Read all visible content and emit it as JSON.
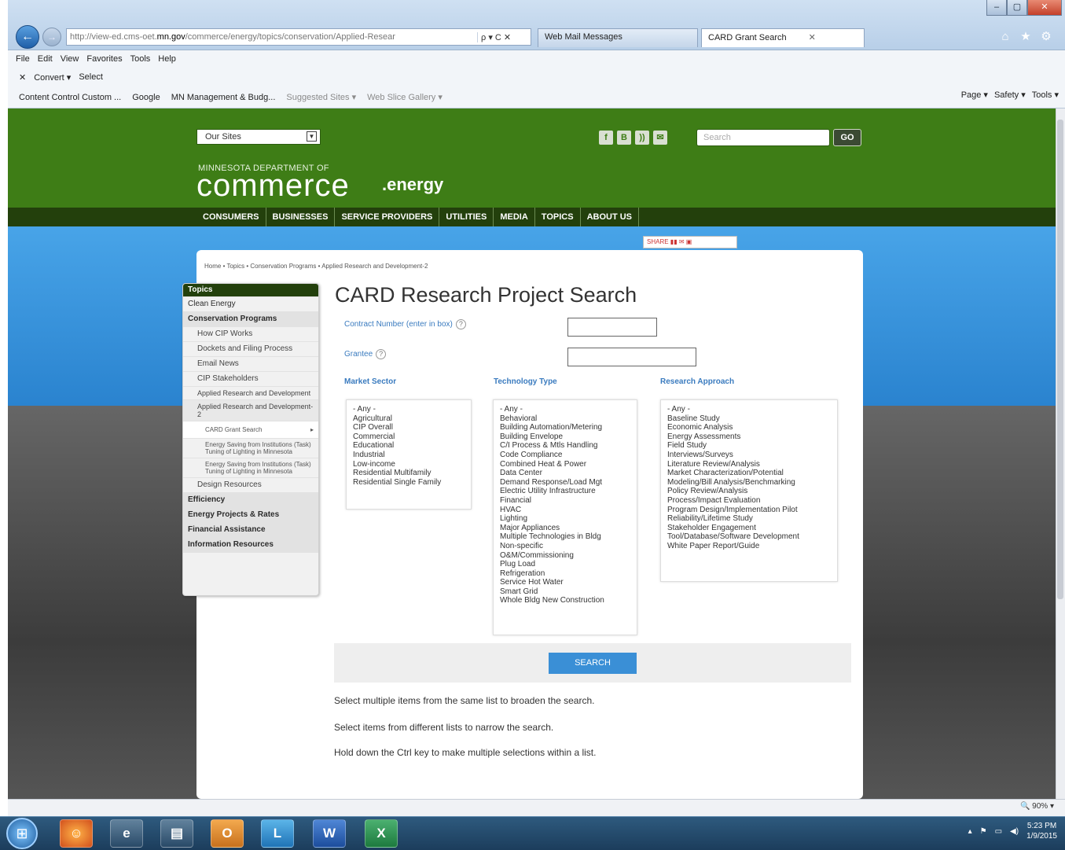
{
  "browser": {
    "address_url_prefix": "http://view-ed.cms-oet.",
    "address_url_host": "mn.gov",
    "address_url_path": "/commerce/energy/topics/conservation/Applied-Resear",
    "address_controls": "ρ ▾ C ✕",
    "tabs": [
      {
        "label": "Web Mail Messages"
      },
      {
        "label": "CARD Grant Search"
      }
    ],
    "tab_close": "✕",
    "menu": [
      "File",
      "Edit",
      "View",
      "Favorites",
      "Tools",
      "Help"
    ],
    "toolbar2": [
      "Convert ▾",
      "Select"
    ],
    "toolbar2_close": "✕",
    "favorites": [
      "Content Control Custom ...",
      "Google",
      "MN Management & Budg...",
      "Suggested Sites ▾",
      "Web Slice Gallery ▾"
    ],
    "command_bar": [
      "Page ▾",
      "Safety ▾",
      "Tools ▾"
    ],
    "window_buttons": [
      "–",
      "▢",
      "✕"
    ]
  },
  "site": {
    "our_sites_label": "Our Sites",
    "search_placeholder": "Search",
    "go_label": "GO",
    "logo_sub": "MINNESOTA DEPARTMENT OF",
    "logo_main": "commerce",
    "logo_suffix": ".energy",
    "nav": [
      "CONSUMERS",
      "BUSINESSES",
      "SERVICE PROVIDERS",
      "UTILITIES",
      "MEDIA",
      "TOPICS",
      "ABOUT US"
    ],
    "share_label": "SHARE",
    "breadcrumb": "Home  •  Topics  •  Conservation Programs  •  Applied Research and Development-2"
  },
  "sidebar": {
    "header": "Topics",
    "items": [
      {
        "label": "Clean Energy"
      },
      {
        "label": "Conservation Programs"
      },
      {
        "label": "How CIP Works"
      },
      {
        "label": "Dockets and Filing Process"
      },
      {
        "label": "Email News"
      },
      {
        "label": "CIP Stakeholders"
      },
      {
        "label": "Applied Research and Development"
      },
      {
        "label": "Applied Research and Development-2"
      },
      {
        "label": "CARD Grant Search"
      },
      {
        "label": "Energy Saving from Institutions (Task) Tuning of Lighting in Minnesota"
      },
      {
        "label": "Energy Saving from Institutions (Task) Tuning of Lighting in Minnesota"
      },
      {
        "label": "Design Resources"
      },
      {
        "label": "Efficiency"
      },
      {
        "label": "Energy Projects & Rates"
      },
      {
        "label": "Financial Assistance"
      },
      {
        "label": "Information Resources"
      }
    ]
  },
  "form": {
    "title": "CARD Research Project Search",
    "contract_label": "Contract Number (enter in box)",
    "grantee_label": "Grantee",
    "help_glyph": "?",
    "market_sector_label": "Market Sector",
    "technology_type_label": "Technology Type",
    "research_approach_label": "Research Approach",
    "market_sector_options": [
      "- Any -",
      "Agricultural",
      "CIP Overall",
      "Commercial",
      "Educational",
      "Industrial",
      "Low-income",
      "Residential Multifamily",
      "Residential Single Family"
    ],
    "technology_type_options": [
      "- Any -",
      "Behavioral",
      "Building Automation/Metering",
      "Building Envelope",
      "C/I Process & Mtls Handling",
      "Code Compliance",
      "Combined Heat & Power",
      "Data Center",
      "Demand Response/Load Mgt",
      "Electric Utility Infrastructure",
      "Financial",
      "HVAC",
      "Lighting",
      "Major Appliances",
      "Multiple Technologies in Bldg",
      "Non-specific",
      "O&M/Commissioning",
      "Plug Load",
      "Refrigeration",
      "Service Hot Water",
      "Smart Grid",
      "Whole Bldg New Construction"
    ],
    "research_approach_options": [
      "- Any -",
      "Baseline Study",
      "Economic Analysis",
      "Energy Assessments",
      "Field Study",
      "Interviews/Surveys",
      "Literature Review/Analysis",
      "Market Characterization/Potential",
      "Modeling/Bill Analysis/Benchmarking",
      "Policy Review/Analysis",
      "Process/Impact Evaluation",
      "Program Design/Implementation Pilot",
      "Reliability/Lifetime Study",
      "Stakeholder Engagement",
      "Tool/Database/Software Development",
      "White Paper Report/Guide"
    ],
    "search_button": "SEARCH",
    "help_lines": [
      "Select multiple items from the same list to broaden the search.",
      "Select items from different lists to narrow the search.",
      "Hold down the Ctrl key to make multiple selections within a list."
    ]
  },
  "status": {
    "zoom": "90%"
  },
  "taskbar": {
    "apps": [
      "Firefox",
      "Internet Explorer",
      "File Explorer",
      "Outlook",
      "Lync",
      "Word",
      "Excel"
    ],
    "app_glyphs": [
      "☺",
      "e",
      "▤",
      "O",
      "L",
      "W",
      "X"
    ],
    "time": "5:23 PM",
    "date": "1/9/2015"
  }
}
